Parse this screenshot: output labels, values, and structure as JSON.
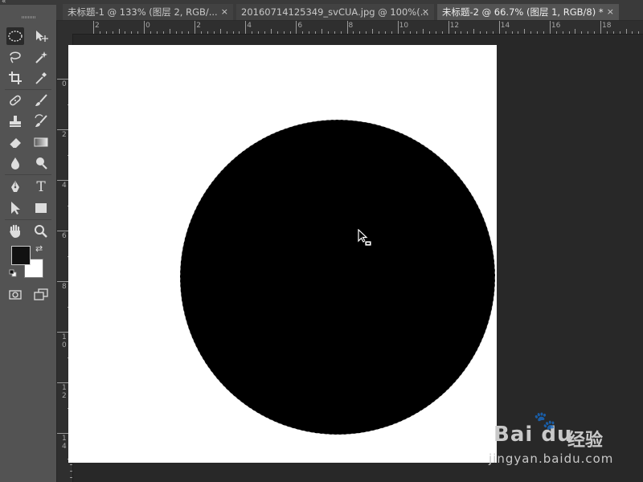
{
  "toolbar": {
    "collapse_glyph": "«",
    "tools": [
      {
        "name": "elliptical-marquee-icon",
        "active": true
      },
      {
        "name": "move-icon"
      },
      {
        "name": "lasso-icon"
      },
      {
        "name": "magic-wand-icon"
      },
      {
        "name": "crop-icon"
      },
      {
        "name": "eyedropper-icon"
      },
      {
        "name": "healing-brush-icon"
      },
      {
        "name": "brush-icon"
      },
      {
        "name": "clone-stamp-icon"
      },
      {
        "name": "history-brush-icon"
      },
      {
        "name": "eraser-icon"
      },
      {
        "name": "gradient-icon"
      },
      {
        "name": "blur-icon"
      },
      {
        "name": "dodge-icon"
      },
      {
        "name": "pen-icon"
      },
      {
        "name": "type-icon"
      },
      {
        "name": "path-selection-icon"
      },
      {
        "name": "rectangle-icon"
      },
      {
        "name": "hand-icon"
      },
      {
        "name": "zoom-icon"
      },
      {
        "name": "quick-mask-icon"
      },
      {
        "name": "screen-mode-icon"
      }
    ],
    "type_glyph": "T",
    "foreground_color": "#111111",
    "background_color": "#ffffff"
  },
  "tabs": [
    {
      "label": "未标题-1 @ 133% (图层 2, RGB/...",
      "close": "×",
      "active": false
    },
    {
      "label": "20160714125349_svCUA.jpg @ 100%(...",
      "close": "×",
      "active": false
    },
    {
      "label": "未标题-2 @ 66.7% (图层 1, RGB/8) *",
      "close": "×",
      "active": true
    }
  ],
  "ruler_top_labels": [
    "2",
    "0",
    "2",
    "4",
    "6",
    "8",
    "10",
    "12",
    "14",
    "16",
    "18"
  ],
  "ruler_left_labels": [
    {
      "a": "0"
    },
    {
      "a": "2"
    },
    {
      "a": "4"
    },
    {
      "a": "6"
    },
    {
      "a": "8"
    },
    {
      "a": "1",
      "b": "0"
    },
    {
      "a": "1",
      "b": "2"
    },
    {
      "a": "1",
      "b": "4"
    }
  ],
  "document": {
    "background": "#ffffff",
    "shape_fill": "#000000",
    "shape": "circle-selection"
  },
  "watermark": {
    "brand": "Bai du",
    "brand_paw": "🐾",
    "suffix": "经验",
    "url": "jingyan.baidu.com"
  }
}
